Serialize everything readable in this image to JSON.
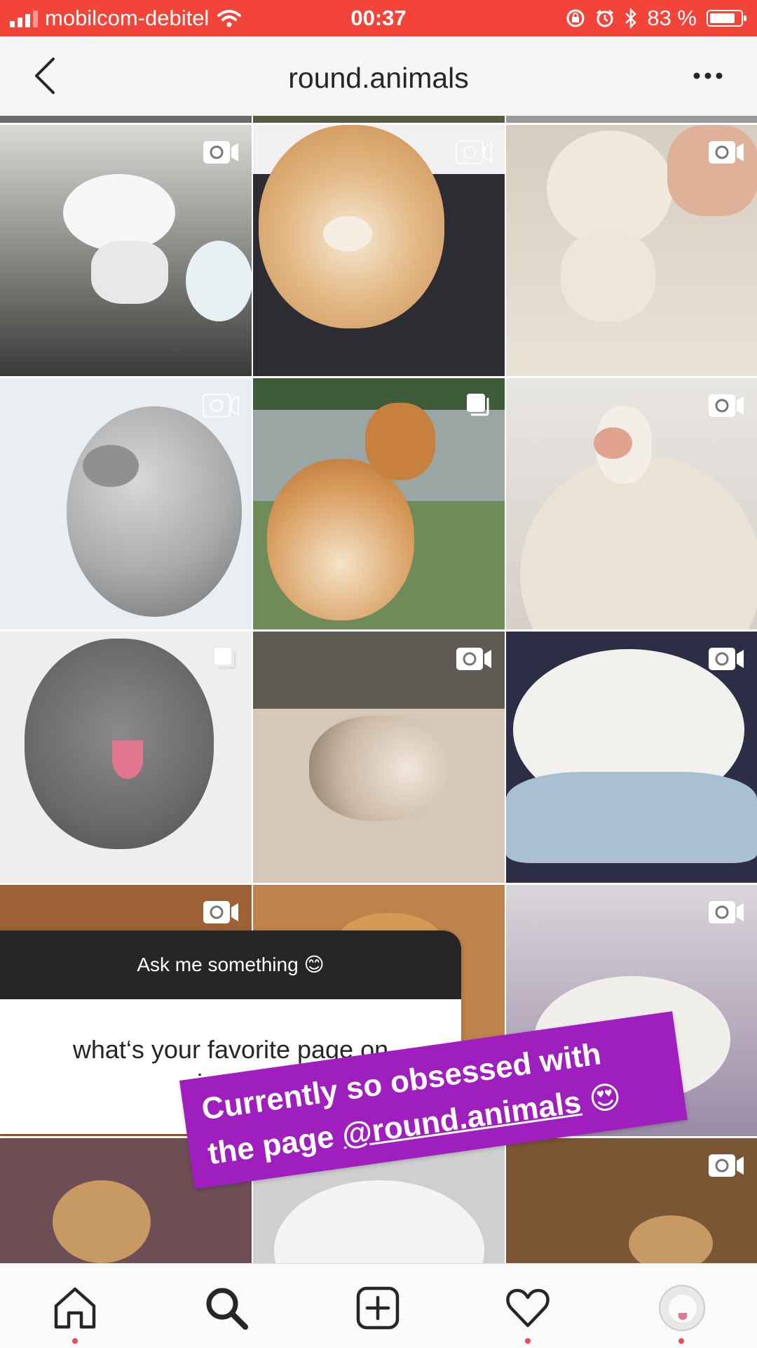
{
  "status_bar": {
    "carrier": "mobilcom-debitel",
    "time": "00:37",
    "battery": "83 %",
    "battery_level": 0.83
  },
  "header": {
    "title": "round.animals"
  },
  "grid": {
    "posts": [
      {
        "label": "soap foam bear"
      },
      {
        "label": "round pomeranian"
      },
      {
        "label": "round bichon"
      },
      {
        "label": "spotted seal"
      },
      {
        "label": "corgi from behind"
      },
      {
        "label": "white duck"
      },
      {
        "label": "grey fluffy poodle"
      },
      {
        "label": "malamute puppy"
      },
      {
        "label": "white puppy in blanket"
      },
      {
        "label": "post"
      },
      {
        "label": "post"
      },
      {
        "label": "white fluffy puppy"
      },
      {
        "label": "fluffy dog in cart"
      },
      {
        "label": "post"
      },
      {
        "label": "post"
      }
    ]
  },
  "story": {
    "question_title": "Ask me something",
    "question_emoji": "😊",
    "question_text": "what‘s your favorite page on insta?",
    "caption_line1": "Currently so obsessed with",
    "caption_line2_prefix": "the page ",
    "caption_mention": "@round.animals",
    "caption_emoji": "😍"
  },
  "colors": {
    "status_bar": "#f3443a",
    "caption_background": "#9e1fbe",
    "notification_dot": "#ed4956"
  },
  "tabs": [
    "home-icon",
    "search-icon",
    "add-post-icon",
    "activity-heart-icon",
    "profile-avatar"
  ]
}
